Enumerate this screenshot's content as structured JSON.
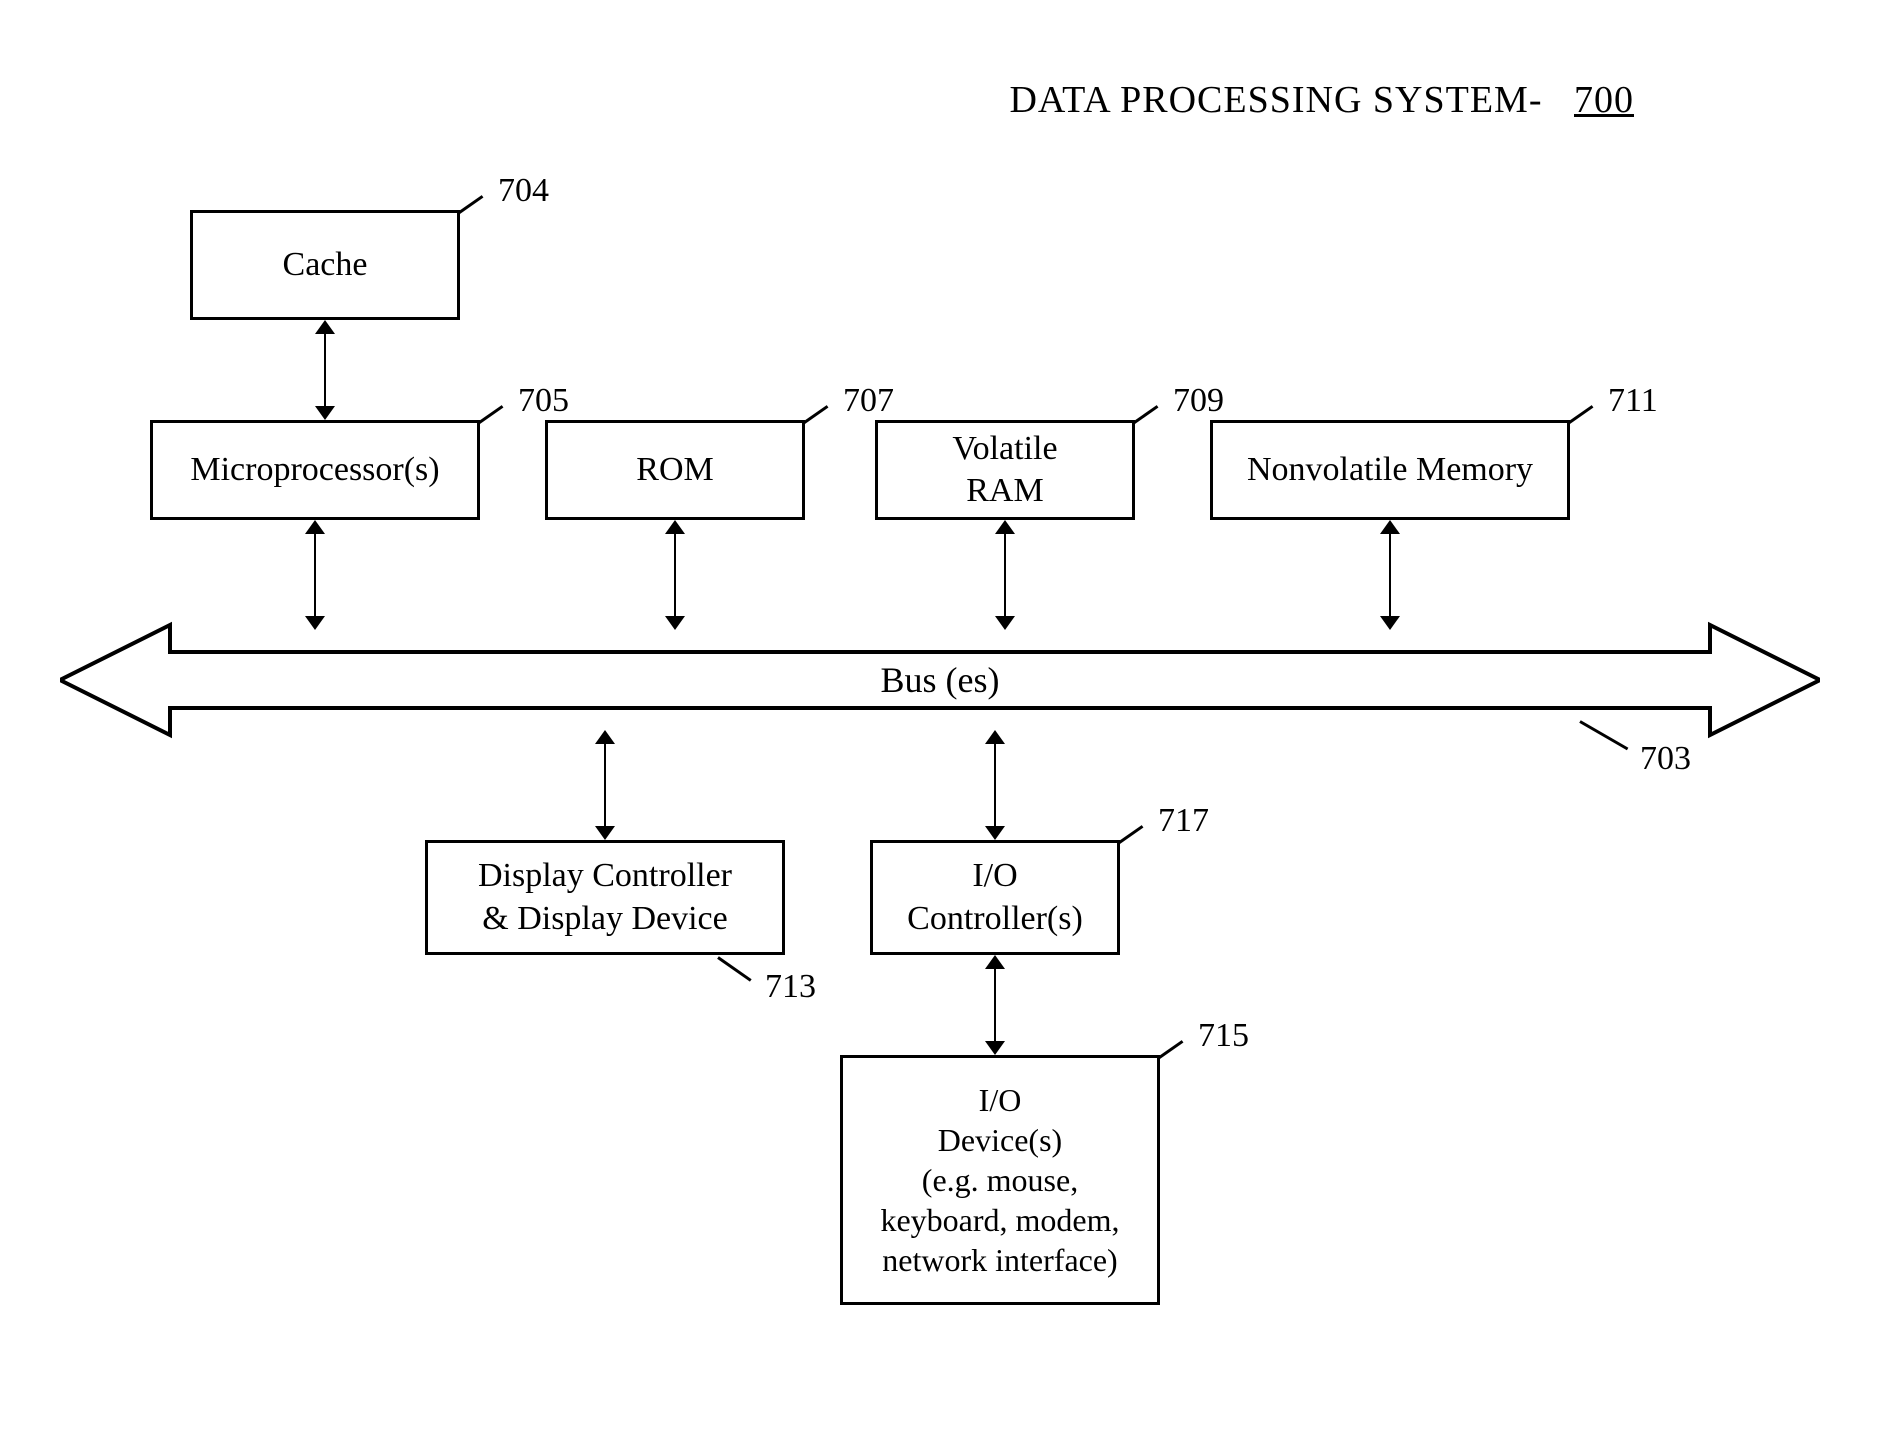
{
  "title": {
    "text": "DATA PROCESSING SYSTEM-",
    "ref": "700"
  },
  "boxes": {
    "cache": {
      "label": "Cache",
      "ref": "704"
    },
    "microprocessor": {
      "label": "Microprocessor(s)",
      "ref": "705"
    },
    "rom": {
      "label": "ROM",
      "ref": "707"
    },
    "vram": {
      "label": "Volatile\nRAM",
      "ref": "709"
    },
    "nvmem": {
      "label": "Nonvolatile Memory",
      "ref": "711"
    },
    "display": {
      "label": "Display Controller\n& Display Device",
      "ref": "713"
    },
    "ioctrl": {
      "label": "I/O\nController(s)",
      "ref": "717"
    },
    "iodev": {
      "label": "I/O\nDevice(s)\n(e.g. mouse,\nkeyboard, modem,\nnetwork interface)",
      "ref": "715"
    }
  },
  "bus": {
    "label": "Bus (es)",
    "ref": "703"
  }
}
